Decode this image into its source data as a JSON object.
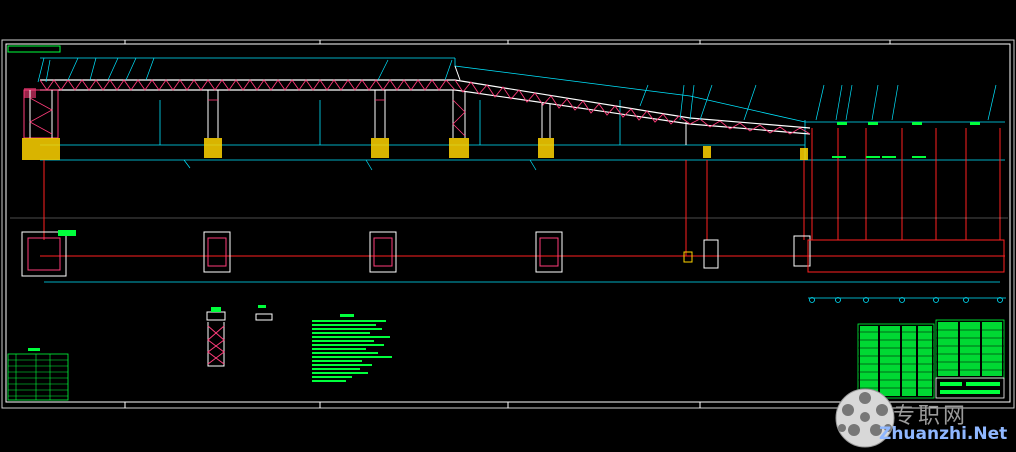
{
  "watermark": {
    "site_name": "专职网",
    "url": "Zhuanzhi.Net",
    "logo_icon": "soccer-ball-logo"
  },
  "colors": {
    "background": "#000000",
    "frame": "#ffffff",
    "truss_outline": "#ffffff",
    "truss_bracing": "#ff3c7a",
    "dimension_lines": "#00e5ff",
    "centerlines": "#ff2020",
    "foundation_hatch": "#ffd400",
    "tables": "#00ff3c",
    "leaders": "#00e5ff"
  },
  "drawing": {
    "type": "CAD belt-conveyor general arrangement",
    "views": [
      "elevation",
      "plan",
      "support-detail",
      "notes",
      "parts-list",
      "title-block"
    ]
  }
}
